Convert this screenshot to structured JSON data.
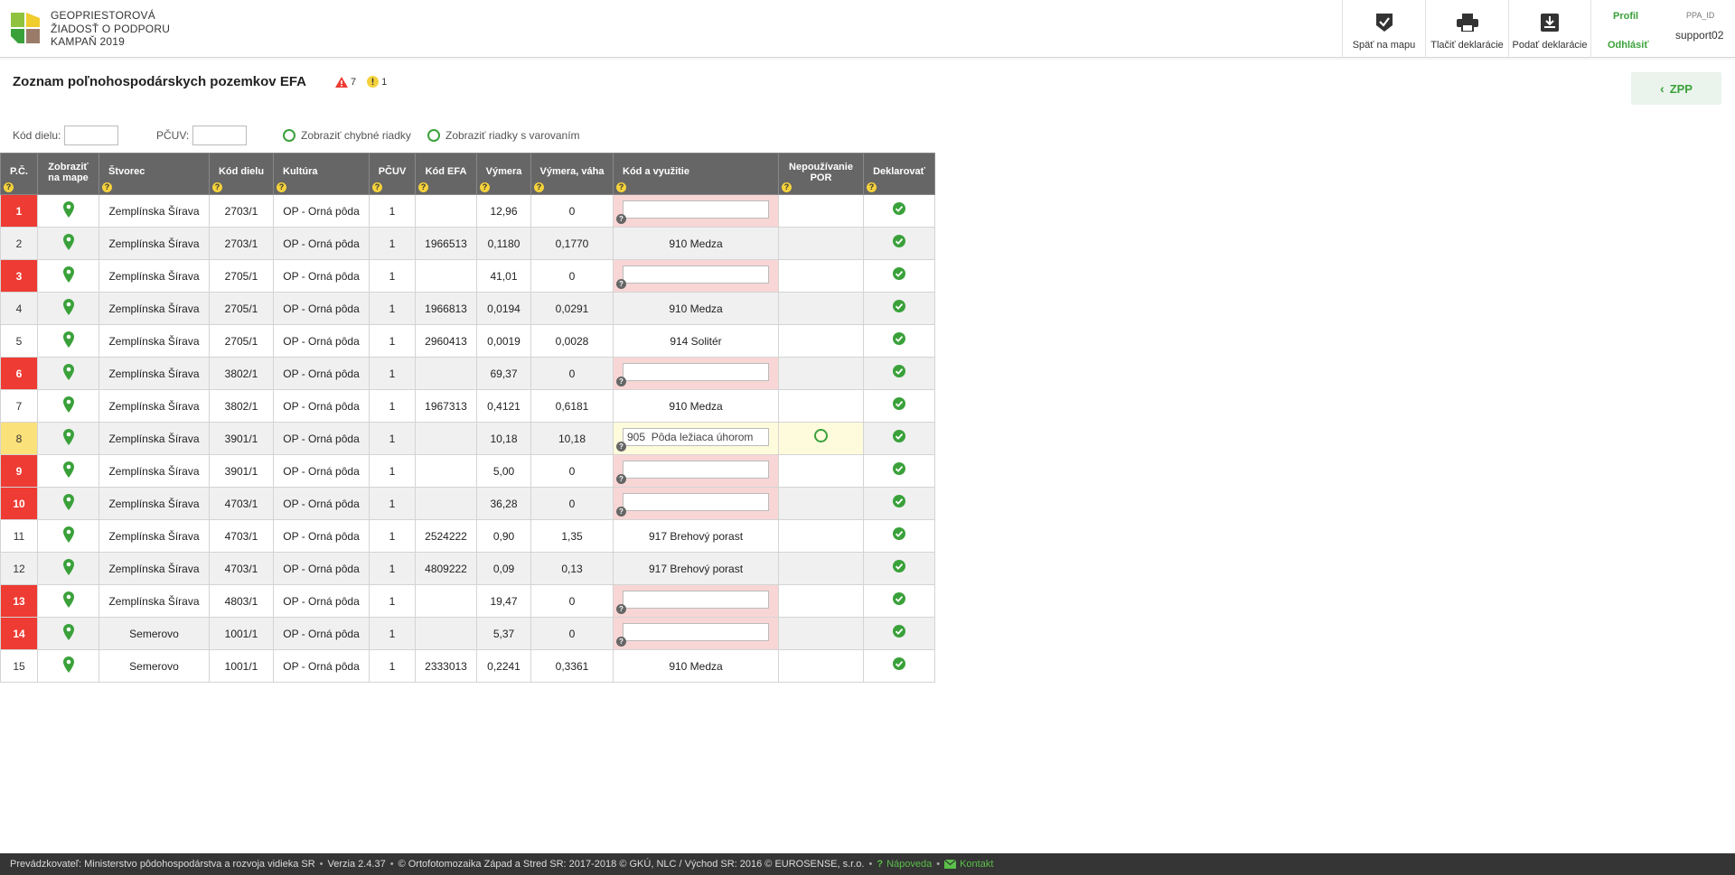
{
  "app": {
    "title_lines": [
      "GEOPRIESTOROVÁ",
      "ŽIADOSŤ O PODPORU",
      "KAMPAŇ 2019"
    ]
  },
  "header": {
    "back_to_map": "Späť na mapu",
    "print": "Tlačiť deklarácie",
    "submit": "Podať deklarácie",
    "profile": "Profil",
    "logout": "Odhlásiť",
    "user_label": "PPA_ID",
    "user_name": "support02"
  },
  "page": {
    "title": "Zoznam poľnohospodárskych pozemkov EFA",
    "error_count": "7",
    "warning_count": "1",
    "zpp_button": "ZPP"
  },
  "filters": {
    "kod_dielu_label": "Kód dielu:",
    "kod_dielu_value": "",
    "pcuv_label": "PČUV:",
    "pcuv_value": "",
    "show_errors_label": "Zobraziť chybné riadky",
    "show_warnings_label": "Zobraziť riadky s varovaním"
  },
  "table": {
    "headers": {
      "pc": "P.Č.",
      "map_line1": "Zobraziť",
      "map_line2": "na mape",
      "stvorec": "Štvorec",
      "kod_dielu": "Kód dielu",
      "kultura": "Kultúra",
      "pcuv": "PČUV",
      "kod_efa": "Kód EFA",
      "vymera": "Výmera",
      "vymera_vaha": "Výmera, váha",
      "kod_vyuzitie": "Kód a využitie",
      "nepouzivanie_line1": "Nepoužívanie",
      "nepouzivanie_line2": "POR",
      "deklarovat": "Deklarovať"
    },
    "rows": [
      {
        "pc": "1",
        "status": "error",
        "stvorec": "Zemplínska Šírava",
        "kod_dielu": "2703/1",
        "kultura": "OP - Orná pôda",
        "pcuv": "1",
        "kod_efa": "",
        "vymera": "12,96",
        "vymera_vaha": "0",
        "kod_vyuzitie": ""
      },
      {
        "pc": "2",
        "status": "ok",
        "stvorec": "Zemplínska Šírava",
        "kod_dielu": "2703/1",
        "kultura": "OP - Orná pôda",
        "pcuv": "1",
        "kod_efa": "1966513",
        "vymera": "0,1180",
        "vymera_vaha": "0,1770",
        "kod_vyuzitie": "910 Medza"
      },
      {
        "pc": "3",
        "status": "error",
        "stvorec": "Zemplínska Šírava",
        "kod_dielu": "2705/1",
        "kultura": "OP - Orná pôda",
        "pcuv": "1",
        "kod_efa": "",
        "vymera": "41,01",
        "vymera_vaha": "0",
        "kod_vyuzitie": ""
      },
      {
        "pc": "4",
        "status": "ok",
        "stvorec": "Zemplínska Šírava",
        "kod_dielu": "2705/1",
        "kultura": "OP - Orná pôda",
        "pcuv": "1",
        "kod_efa": "1966813",
        "vymera": "0,0194",
        "vymera_vaha": "0,0291",
        "kod_vyuzitie": "910 Medza"
      },
      {
        "pc": "5",
        "status": "ok",
        "stvorec": "Zemplínska Šírava",
        "kod_dielu": "2705/1",
        "kultura": "OP - Orná pôda",
        "pcuv": "1",
        "kod_efa": "2960413",
        "vymera": "0,0019",
        "vymera_vaha": "0,0028",
        "kod_vyuzitie": "914 Solitér"
      },
      {
        "pc": "6",
        "status": "error",
        "stvorec": "Zemplínska Šírava",
        "kod_dielu": "3802/1",
        "kultura": "OP - Orná pôda",
        "pcuv": "1",
        "kod_efa": "",
        "vymera": "69,37",
        "vymera_vaha": "0",
        "kod_vyuzitie": ""
      },
      {
        "pc": "7",
        "status": "ok",
        "stvorec": "Zemplínska Šírava",
        "kod_dielu": "3802/1",
        "kultura": "OP - Orná pôda",
        "pcuv": "1",
        "kod_efa": "1967313",
        "vymera": "0,4121",
        "vymera_vaha": "0,6181",
        "kod_vyuzitie": "910 Medza"
      },
      {
        "pc": "8",
        "status": "warning",
        "stvorec": "Zemplínska Šírava",
        "kod_dielu": "3901/1",
        "kultura": "OP - Orná pôda",
        "pcuv": "1",
        "kod_efa": "",
        "vymera": "10,18",
        "vymera_vaha": "10,18",
        "kod_vyuzitie": "905  Pôda ležiaca úhorom"
      },
      {
        "pc": "9",
        "status": "error",
        "stvorec": "Zemplínska Šírava",
        "kod_dielu": "3901/1",
        "kultura": "OP - Orná pôda",
        "pcuv": "1",
        "kod_efa": "",
        "vymera": "5,00",
        "vymera_vaha": "0",
        "kod_vyuzitie": ""
      },
      {
        "pc": "10",
        "status": "error",
        "stvorec": "Zemplínska Šírava",
        "kod_dielu": "4703/1",
        "kultura": "OP - Orná pôda",
        "pcuv": "1",
        "kod_efa": "",
        "vymera": "36,28",
        "vymera_vaha": "0",
        "kod_vyuzitie": ""
      },
      {
        "pc": "11",
        "status": "ok",
        "stvorec": "Zemplínska Šírava",
        "kod_dielu": "4703/1",
        "kultura": "OP - Orná pôda",
        "pcuv": "1",
        "kod_efa": "2524222",
        "vymera": "0,90",
        "vymera_vaha": "1,35",
        "kod_vyuzitie": "917 Brehový porast"
      },
      {
        "pc": "12",
        "status": "ok",
        "stvorec": "Zemplínska Šírava",
        "kod_dielu": "4703/1",
        "kultura": "OP - Orná pôda",
        "pcuv": "1",
        "kod_efa": "4809222",
        "vymera": "0,09",
        "vymera_vaha": "0,13",
        "kod_vyuzitie": "917 Brehový porast"
      },
      {
        "pc": "13",
        "status": "error",
        "stvorec": "Zemplínska Šírava",
        "kod_dielu": "4803/1",
        "kultura": "OP - Orná pôda",
        "pcuv": "1",
        "kod_efa": "",
        "vymera": "19,47",
        "vymera_vaha": "0",
        "kod_vyuzitie": ""
      },
      {
        "pc": "14",
        "status": "error",
        "stvorec": "Semerovo",
        "kod_dielu": "1001/1",
        "kultura": "OP - Orná pôda",
        "pcuv": "1",
        "kod_efa": "",
        "vymera": "5,37",
        "vymera_vaha": "0",
        "kod_vyuzitie": ""
      },
      {
        "pc": "15",
        "status": "ok",
        "stvorec": "Semerovo",
        "kod_dielu": "1001/1",
        "kultura": "OP - Orná pôda",
        "pcuv": "1",
        "kod_efa": "2333013",
        "vymera": "0,2241",
        "vymera_vaha": "0,3361",
        "kod_vyuzitie": "910 Medza"
      }
    ]
  },
  "footer": {
    "operator": "Prevádzkovateľ: Ministerstvo pôdohospodárstva a rozvoja vidieka SR",
    "version": "Verzia 2.4.37",
    "copyright": "© Ortofotomozaika Západ a Stred SR: 2017-2018 © GKÚ, NLC / Východ SR: 2016 © EUROSENSE, s.r.o.",
    "help": "Nápoveda",
    "contact": "Kontakt"
  },
  "colors": {
    "accent_green": "#3aa13a",
    "error_red": "#ee3b33",
    "warning_yellow": "#fbe17a",
    "header_gray": "#666666",
    "footer_bg": "#353535"
  }
}
